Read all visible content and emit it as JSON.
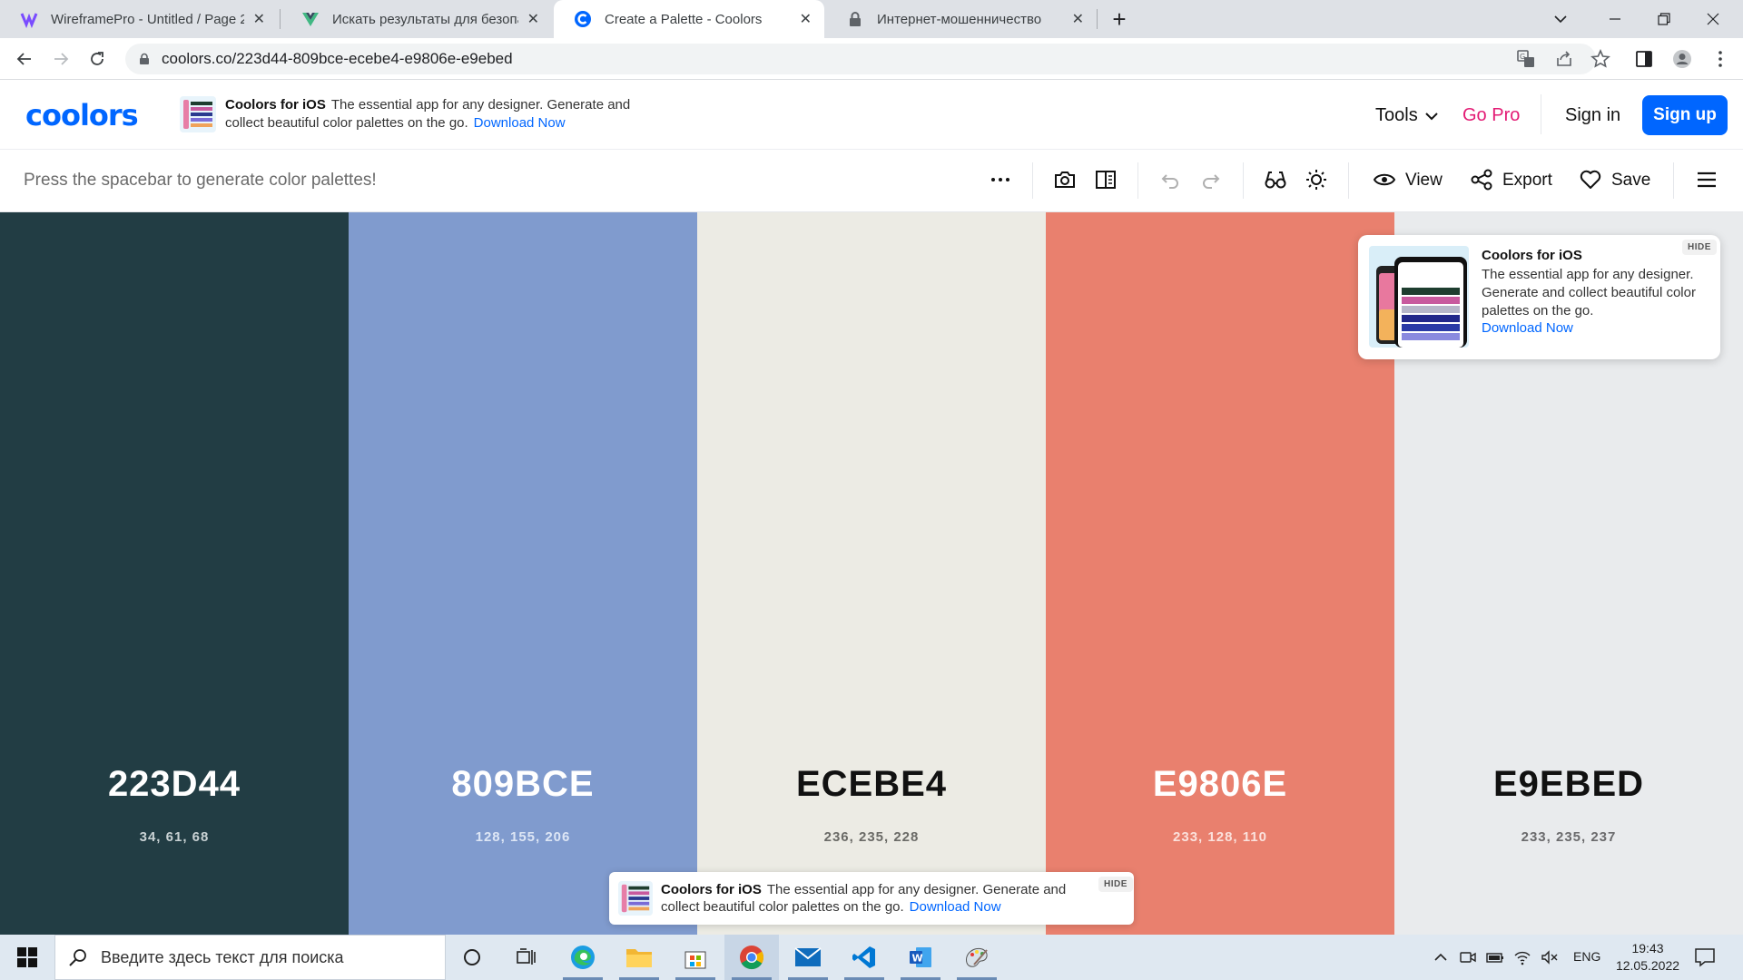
{
  "browser": {
    "tabs": [
      {
        "title": "WireframePro - Untitled / Page 2",
        "close": "✕"
      },
      {
        "title": "Искать результаты для безопасн",
        "close": "✕"
      },
      {
        "title": "Create a Palette - Coolors",
        "close": "✕"
      },
      {
        "title": "Интернет-мошенничество",
        "close": "✕"
      }
    ],
    "new_tab": "+",
    "url": "coolors.co/223d44-809bce-ecebe4-e9806e-e9ebed"
  },
  "site": {
    "logo": "coolors",
    "header_promo": {
      "title": "Coolors for iOS",
      "body": "The essential app for any designer. Generate and collect beautiful color palettes on the go.",
      "link": "Download Now"
    },
    "nav": {
      "tools": "Tools",
      "gopro": "Go Pro",
      "signin": "Sign in",
      "signup": "Sign up"
    }
  },
  "toolbar": {
    "hint": "Press the spacebar to generate color palettes!",
    "view": "View",
    "export": "Export",
    "save": "Save"
  },
  "palette": [
    {
      "hex": "223D44",
      "rgb": "34, 61, 68",
      "color": "#223d44",
      "text_color": "#ffffff",
      "rgb_color": "#c9d2d4"
    },
    {
      "hex": "809BCE",
      "rgb": "128, 155, 206",
      "color": "#809bce",
      "text_color": "#ffffff",
      "rgb_color": "#dde6f5"
    },
    {
      "hex": "ECEBE4",
      "rgb": "236, 235, 228",
      "color": "#ecebe4",
      "text_color": "#111111",
      "rgb_color": "#6a6a66"
    },
    {
      "hex": "E9806E",
      "rgb": "233, 128, 110",
      "color": "#e9806e",
      "text_color": "#ffffff",
      "rgb_color": "#fbe1dc"
    },
    {
      "hex": "E9EBED",
      "rgb": "233, 235, 237",
      "color": "#e9ebed",
      "text_color": "#111111",
      "rgb_color": "#6a6a6c"
    }
  ],
  "ios_card": {
    "title": "Coolors for iOS",
    "body": "The essential app for any designer. Generate and collect beautiful color palettes on the go.",
    "link": "Download Now",
    "hide": "HIDE"
  },
  "bottom_promo": {
    "title": "Coolors for iOS",
    "body": "The essential app for any designer. Generate and collect beautiful color palettes on the go.",
    "link": "Download Now",
    "hide": "HIDE"
  },
  "taskbar": {
    "search_placeholder": "Введите здесь текст для поиска",
    "lang": "ENG",
    "time": "19:43",
    "date": "12.05.2022"
  },
  "colors": {
    "accent": "#0066ff",
    "gopro": "#e31b74"
  }
}
